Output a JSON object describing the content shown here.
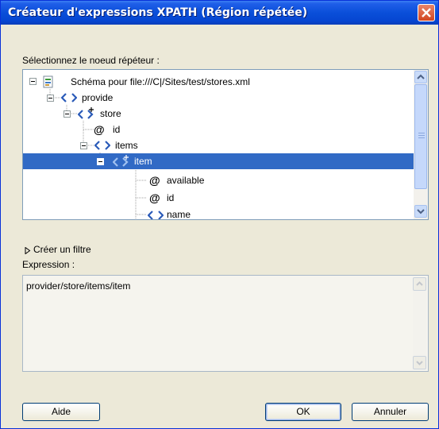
{
  "window": {
    "title": "Créateur d'expressions XPATH (Région répétée)"
  },
  "tree": {
    "label": "Sélectionnez le noeud répéteur :",
    "nodes": [
      {
        "text": "Schéma pour file:///C|/Sites/test/stores.xml",
        "icon": "schema-file-icon"
      },
      {
        "text": "provide",
        "icon": "element-icon"
      },
      {
        "text": "store",
        "icon": "repeating-element-icon"
      },
      {
        "text": "id",
        "icon": "attribute-icon"
      },
      {
        "text": "items",
        "icon": "element-icon"
      },
      {
        "text": "item",
        "icon": "repeating-element-icon",
        "selected": true
      },
      {
        "text": "available",
        "icon": "attribute-icon"
      },
      {
        "text": "id",
        "icon": "attribute-icon"
      },
      {
        "text": "name",
        "icon": "element-icon"
      }
    ]
  },
  "filter": {
    "label": "Créer un filtre"
  },
  "expression": {
    "label": "Expression :",
    "value": "provider/store/items/item"
  },
  "buttons": {
    "help": "Aide",
    "ok": "OK",
    "cancel": "Annuler"
  },
  "colors": {
    "titlebar": "#0a4fd9",
    "selection": "#316ac5",
    "dialog_bg": "#ece9d8"
  }
}
